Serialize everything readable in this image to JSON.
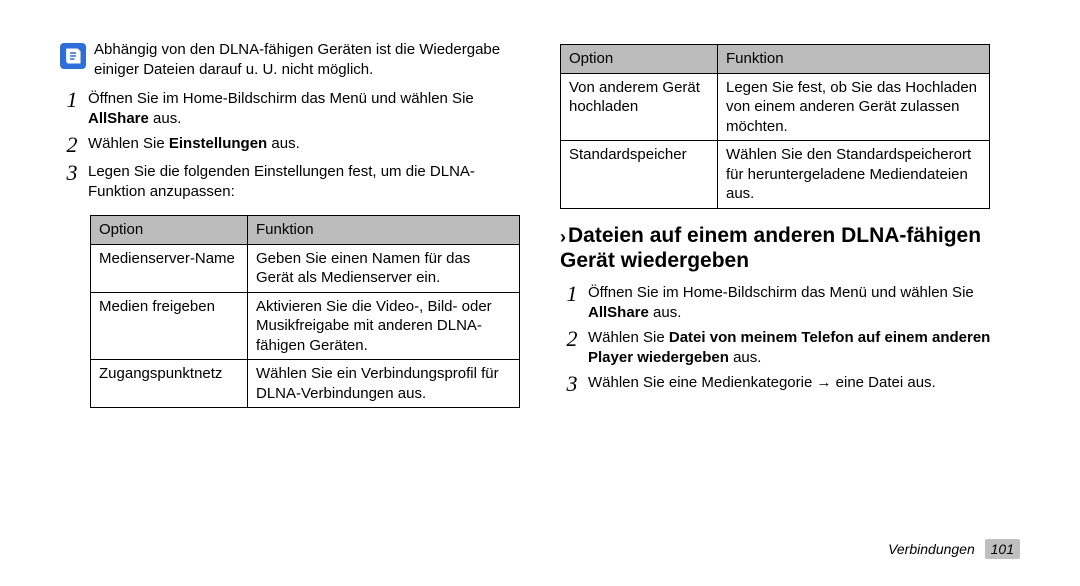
{
  "left": {
    "note_text": "Abhängig von den DLNA-fähigen Geräten ist die Wiedergabe einiger Dateien darauf u. U. nicht möglich.",
    "steps": [
      {
        "num": "1",
        "text_pre": "Öffnen Sie im Home-Bildschirm das Menü und wählen Sie ",
        "bold": "AllShare",
        "text_post": " aus."
      },
      {
        "num": "2",
        "text_pre": "Wählen Sie ",
        "bold": "Einstellungen",
        "text_post": " aus."
      },
      {
        "num": "3",
        "text_pre": "Legen Sie die folgenden Einstellungen fest, um die DLNA-Funktion anzupassen:",
        "bold": "",
        "text_post": ""
      }
    ],
    "table": {
      "headers": [
        "Option",
        "Funktion"
      ],
      "rows": [
        [
          "Medienserver-Name",
          "Geben Sie einen Namen für das Gerät als Medienserver ein."
        ],
        [
          "Medien freigeben",
          "Aktivieren Sie die Video-, Bild- oder Musikfreigabe mit anderen DLNA-fähigen Geräten."
        ],
        [
          "Zugangspunktnetz",
          "Wählen Sie ein Verbindungsprofil für DLNA-Verbindungen aus."
        ]
      ]
    }
  },
  "right": {
    "table": {
      "headers": [
        "Option",
        "Funktion"
      ],
      "rows": [
        [
          "Von anderem Gerät hochladen",
          "Legen Sie fest, ob Sie das Hochladen von einem anderen Gerät zulassen möchten."
        ],
        [
          "Standardspeicher",
          "Wählen Sie den Standardspeicherort für heruntergeladene Mediendateien aus."
        ]
      ]
    },
    "heading": "Dateien auf einem anderen DLNA-fähigen Gerät wiedergeben",
    "steps": [
      {
        "num": "1",
        "text_pre": "Öffnen Sie im Home-Bildschirm das Menü und wählen Sie ",
        "bold": "AllShare",
        "text_post": " aus."
      },
      {
        "num": "2",
        "text_pre": "Wählen Sie ",
        "bold": "Datei von meinem Telefon auf einem anderen Player wiedergeben",
        "text_post": " aus."
      },
      {
        "num": "3",
        "text_pre": "Wählen Sie eine Medienkategorie → eine Datei aus.",
        "bold": "",
        "text_post": ""
      }
    ]
  },
  "footer": {
    "section": "Verbindungen",
    "page": "101"
  },
  "icons": {
    "note": "note-icon"
  },
  "chevron": "›"
}
